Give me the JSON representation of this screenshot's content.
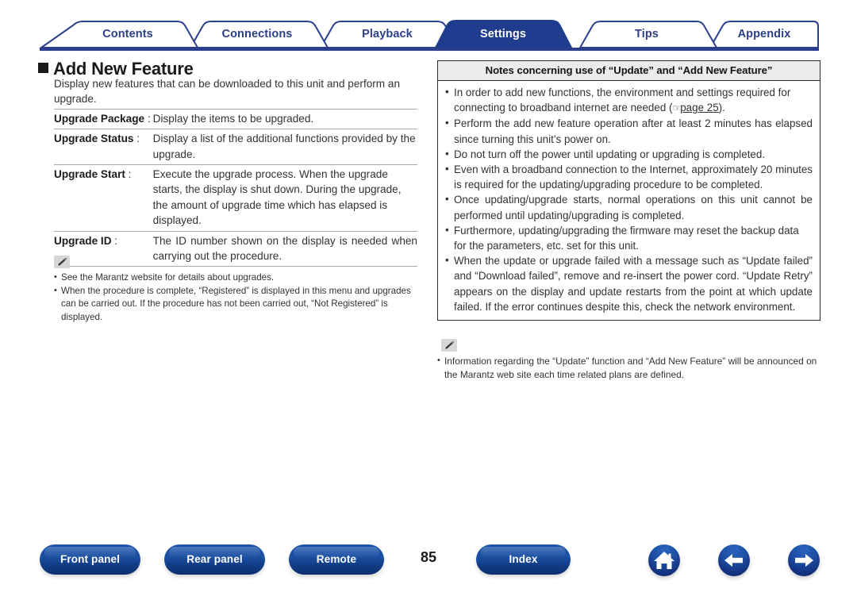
{
  "tabs": [
    {
      "label": "Contents",
      "active": false
    },
    {
      "label": "Connections",
      "active": false
    },
    {
      "label": "Playback",
      "active": false
    },
    {
      "label": "Settings",
      "active": true
    },
    {
      "label": "Tips",
      "active": false
    },
    {
      "label": "Appendix",
      "active": false
    }
  ],
  "heading": "Add New Feature",
  "intro": "Display new features that can be downloaded to this unit and perform an upgrade.",
  "definitions": [
    {
      "term": "Upgrade Package",
      "colon": " : ",
      "desc": "Display the items to be upgraded."
    },
    {
      "term": "Upgrade Status",
      "colon": " : ",
      "desc": "Display a list of the additional functions provided by the upgrade."
    },
    {
      "term": "Upgrade Start",
      "colon": " : ",
      "desc": "Execute the upgrade process. When the upgrade starts, the display is shut down. During the upgrade, the amount of upgrade time which has elapsed is displayed."
    },
    {
      "term": "Upgrade ID",
      "colon": " : ",
      "desc": "The ID number shown on the display is needed when carrying out the procedure."
    }
  ],
  "left_note": {
    "icon": "pencil-icon",
    "items": [
      "See the Marantz website for details about upgrades.",
      "When the procedure is complete, “Registered” is displayed in this menu and upgrades can be carried out. If the procedure has not been carried out, “Not Registered” is displayed."
    ]
  },
  "notes_panel": {
    "title": "Notes concerning use of “Update” and “Add New Feature”",
    "items": [
      {
        "text_before": "In order to add new functions, the environment and settings required for connecting to broadband internet are needed (",
        "link": "page 25",
        "text_after": ")."
      },
      {
        "text": "Perform the add new feature operation after at least 2 minutes has elapsed since turning this unit’s power on."
      },
      {
        "text": "Do not turn off the power until updating or upgrading is completed."
      },
      {
        "text": "Even with a broadband connection to the Internet, approximately 20 minutes is required for the updating/upgrading procedure to be completed."
      },
      {
        "text": "Once updating/upgrade starts, normal operations on this unit cannot be performed until updating/upgrading is completed."
      },
      {
        "text": "Furthermore, updating/upgrading the firmware may reset the backup data for the parameters, etc. set for this unit."
      },
      {
        "text": "When the update or upgrade failed with a message such as “Update failed” and “Download failed”, remove and re-insert the power cord. “Update Retry” appears on the display and update restarts from the point at which update failed. If the error continues despite this, check the network environment."
      }
    ]
  },
  "right_note": {
    "icon": "pencil-icon",
    "items": [
      "Information regarding the “Update” function and “Add New Feature” will be announced on the Marantz web site each time related plans are defined."
    ]
  },
  "footer": {
    "buttons": [
      {
        "label": "Front panel"
      },
      {
        "label": "Rear panel"
      },
      {
        "label": "Remote"
      },
      {
        "label": "Index"
      }
    ],
    "page_number": "85",
    "icons": [
      {
        "name": "home-icon"
      },
      {
        "name": "back-arrow-icon"
      },
      {
        "name": "forward-arrow-icon"
      }
    ]
  },
  "colors": {
    "tab_text": "#2b3f8c",
    "tab_active_bg": "#1f3c8e",
    "accent_blue": "#1b4fa2",
    "rule_grey": "#a9a9ad",
    "panel_header_bg": "#eceaea"
  }
}
